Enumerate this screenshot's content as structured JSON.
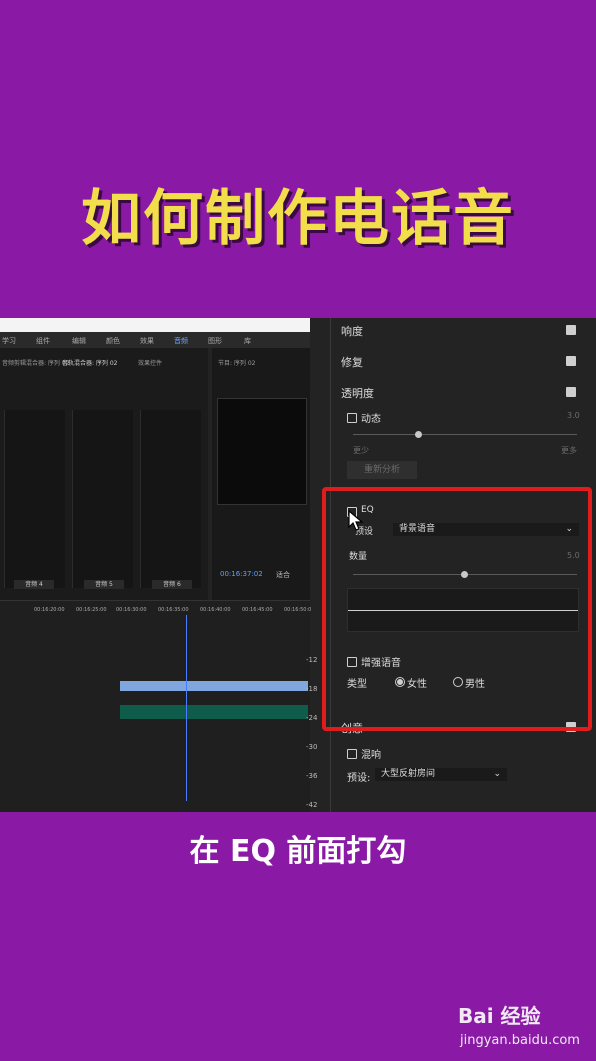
{
  "title": "如何制作电话音",
  "caption": "在 EQ 前面打勾",
  "watermark": {
    "logo": "Bai 经验",
    "url": "jingyan.baidu.com"
  },
  "workspace_tabs": [
    "学习",
    "组件",
    "编辑",
    "颜色",
    "效果",
    "音频",
    "图形",
    "库"
  ],
  "mixer": {
    "header": [
      "音频剪辑混合器: 序列 02",
      "音轨混合器: 序列 02",
      "效果控件"
    ],
    "channels": [
      "音频 4",
      "音频 5",
      "音频 6"
    ]
  },
  "monitor": {
    "header": "节目: 序列 02",
    "timecode": "00:16:37:02",
    "fit": "适合"
  },
  "timeline": {
    "ruler": [
      "00:16:20:00",
      "00:16:25:00",
      "00:16:30:00",
      "00:16:35:00",
      "00:16:40:00",
      "00:16:45:00",
      "00:16:50:0"
    ],
    "db_scale": [
      "-12",
      "-18",
      "-24",
      "-30",
      "-36",
      "-42"
    ]
  },
  "panel": {
    "loudness": "响度",
    "repair": "修复",
    "clarity": "透明度",
    "dynamics": "动态",
    "dynamics_value": "3.0",
    "less": "更少",
    "more": "更多",
    "reanalyze": "重新分析",
    "eq_label": "EQ",
    "preset_label": "预设",
    "preset_value": "背景语音",
    "amount_label": "数量",
    "amount_value": "5.0",
    "enhance_speech": "增强语音",
    "type_label": "类型",
    "female": "女性",
    "male": "男性",
    "creative": "创意",
    "reverb": "混响",
    "reverb_preset_label": "预设:",
    "reverb_preset_value": "大型反射房间"
  },
  "colors": {
    "background": "#8a1aa6",
    "title": "#f2dd4a",
    "highlight": "#e11c1c",
    "accent_blue": "#4a7cff"
  }
}
